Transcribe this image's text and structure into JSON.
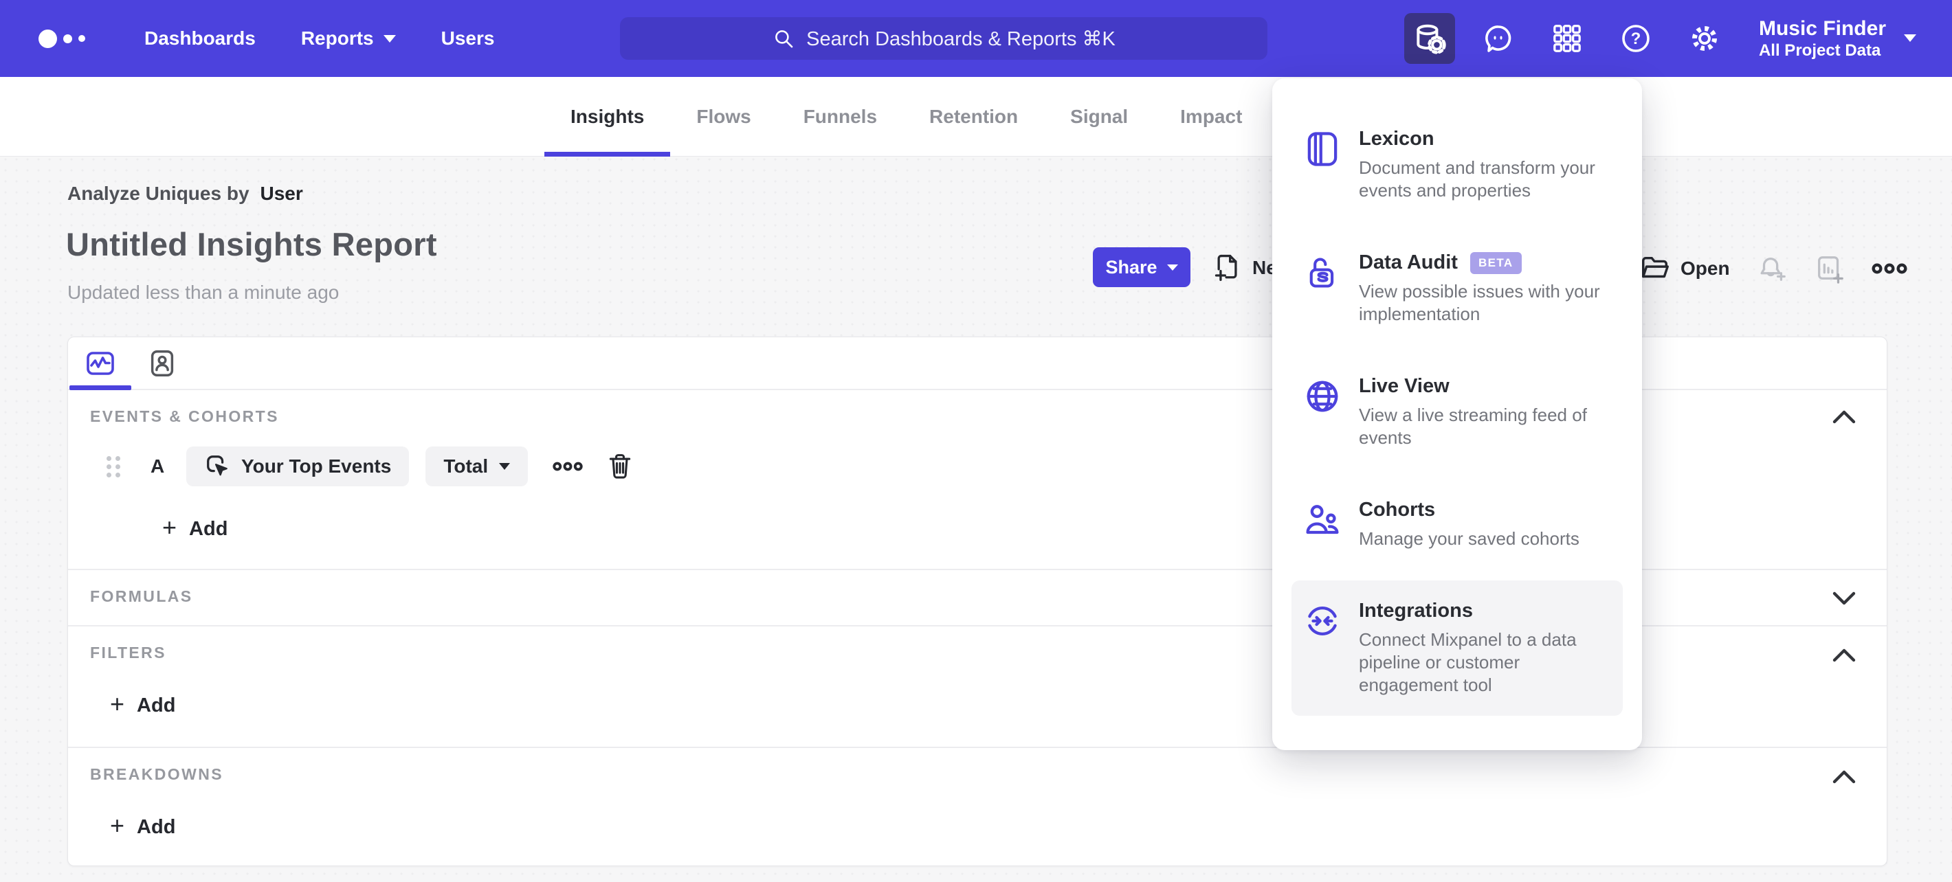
{
  "nav": {
    "items": [
      {
        "label": "Dashboards",
        "has_caret": false
      },
      {
        "label": "Reports",
        "has_caret": true
      },
      {
        "label": "Users",
        "has_caret": false
      }
    ],
    "search_placeholder": "Search Dashboards & Reports ⌘K",
    "project": {
      "name": "Music Finder",
      "scope": "All Project Data"
    },
    "icons": [
      "data-management-icon",
      "feedback-chat-icon",
      "apps-grid-icon",
      "help-icon",
      "settings-gear-icon"
    ]
  },
  "report_tabs": {
    "items": [
      "Insights",
      "Flows",
      "Funnels",
      "Retention",
      "Signal",
      "Impact"
    ],
    "active": "Insights"
  },
  "report_header": {
    "analyze_label": "Analyze Uniques by",
    "analyze_value": "User",
    "title": "Untitled Insights Report",
    "updated": "Updated less than a minute ago",
    "share_label": "Share",
    "new_label": "New",
    "open_label": "Open"
  },
  "query_panel": {
    "tab_icons": [
      "insights-chart-icon",
      "profiles-card-icon"
    ],
    "sections": {
      "events": {
        "label": "EVENTS & COHORTS",
        "row": {
          "series_letter": "A",
          "event_name": "Your Top Events",
          "aggregation": "Total"
        },
        "add_label": "Add",
        "state": "expanded"
      },
      "formulas": {
        "label": "FORMULAS",
        "state": "collapsed"
      },
      "filters": {
        "label": "FILTERS",
        "add_label": "Add",
        "state": "expanded"
      },
      "breakdowns": {
        "label": "BREAKDOWNS",
        "add_label": "Add",
        "state": "expanded"
      }
    }
  },
  "data_menu": {
    "items": [
      {
        "title": "Lexicon",
        "description": "Document and transform your events and properties",
        "icon": "lexicon-book-icon"
      },
      {
        "title": "Data Audit",
        "badge": "BETA",
        "description": "View possible issues with your implementation",
        "icon": "data-audit-lock-icon"
      },
      {
        "title": "Live View",
        "description": "View a live streaming feed of events",
        "icon": "live-view-globe-icon"
      },
      {
        "title": "Cohorts",
        "description": "Manage your saved cohorts",
        "icon": "cohorts-people-icon"
      },
      {
        "title": "Integrations",
        "description": "Connect Mixpanel to a data pipeline or customer engagement tool",
        "icon": "integrations-sync-icon",
        "highlighted": true
      }
    ]
  },
  "colors": {
    "nav_purple": "#4c42dd",
    "search_bg": "#443ac6",
    "active_icon_bg": "#3a3384",
    "accent": "#4c42dd",
    "beta_badge": "#a9a1ea",
    "page_bg": "#f6f6f7",
    "muted_text": "#97999f",
    "dark_text": "#26282e"
  }
}
